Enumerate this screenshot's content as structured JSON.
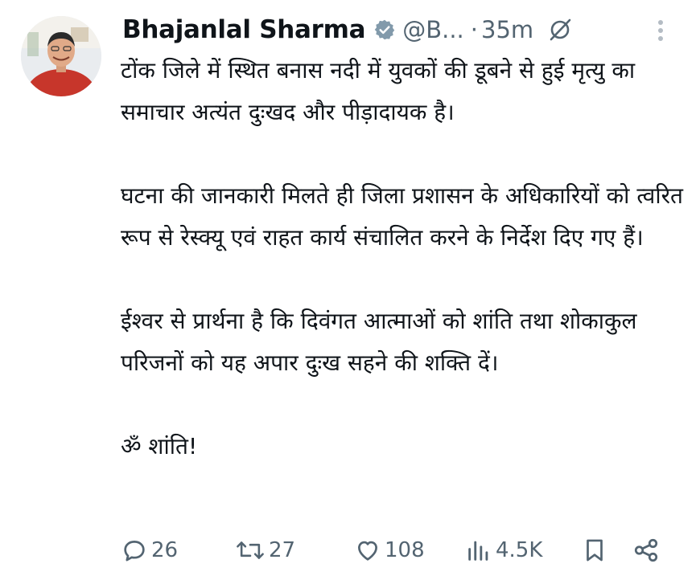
{
  "post": {
    "author_name": "Bhajanlal Sharma",
    "handle": "@B...",
    "separator": "·",
    "time": "35m",
    "verified": true,
    "icons": {
      "avatar": "profile-photo",
      "verified": "verified-badge-icon",
      "grok": "grok-icon",
      "more": "more-vertical-icon"
    },
    "paragraphs": [
      "टोंक जिले में स्थित बनास नदी में युवकों की डूबने से हुई मृत्यु का समाचार अत्यंत दुःखद और पीड़ादायक है।",
      "घटना की जानकारी मिलते ही जिला प्रशासन के अधिकारियों को त्वरित रूप से रेस्क्यू एवं राहत कार्य संचालित करने के निर्देश दिए गए हैं।",
      "ईश्वर से प्रार्थना है कि दिवंगत आत्माओं को शांति तथा शोकाकुल परिजनों को यह अपार दुःख सहने की शक्ति दें।",
      "ॐ शांति!"
    ]
  },
  "actions": {
    "replies": "26",
    "reposts": "27",
    "likes": "108",
    "views": "4.5K",
    "icons": [
      "reply-icon",
      "repost-icon",
      "like-icon",
      "views-icon",
      "bookmark-icon",
      "share-icon"
    ]
  },
  "colors": {
    "text": "#0f1419",
    "secondary": "#536471",
    "verified_badge": "#829aab"
  }
}
